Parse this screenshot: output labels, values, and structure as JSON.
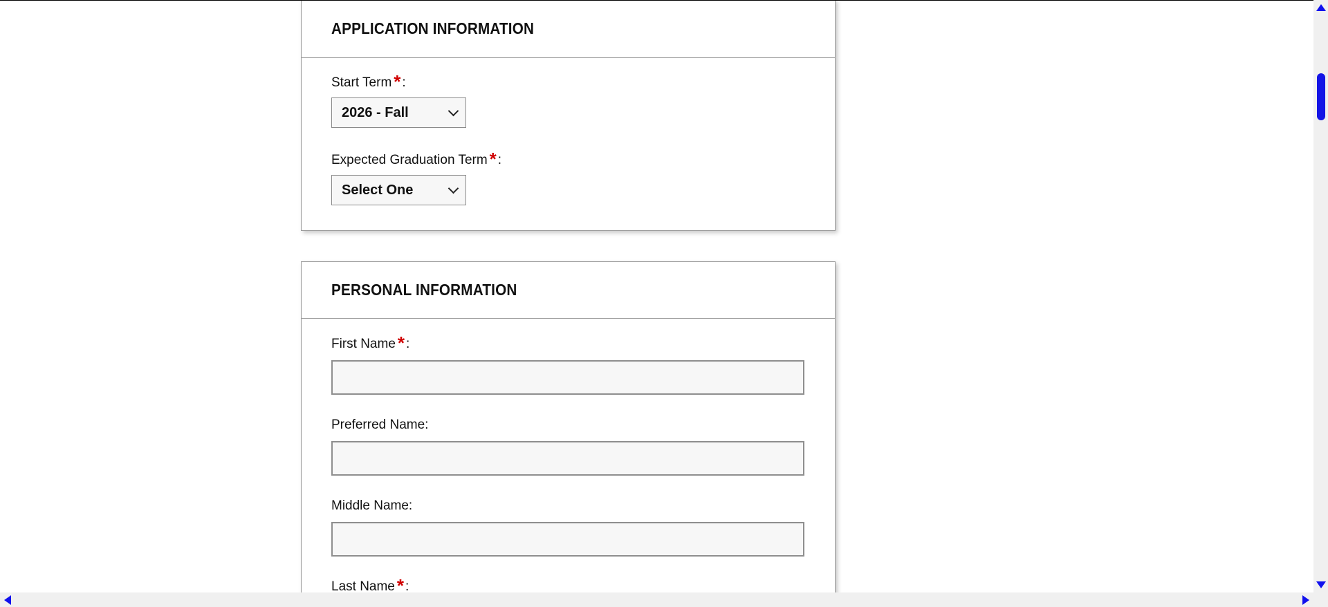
{
  "application_section": {
    "title": "APPLICATION INFORMATION",
    "start_term": {
      "label": "Start Term",
      "required_mark": "*",
      "suffix": ":",
      "selected": "2026 - Fall"
    },
    "graduation_term": {
      "label": "Expected Graduation Term",
      "required_mark": "*",
      "suffix": ":",
      "selected": "Select One"
    }
  },
  "personal_section": {
    "title": "PERSONAL INFORMATION",
    "first_name": {
      "label": "First Name",
      "required_mark": "*",
      "suffix": ":",
      "value": ""
    },
    "preferred_name": {
      "label": "Preferred Name:",
      "value": ""
    },
    "middle_name": {
      "label": "Middle Name:",
      "value": ""
    },
    "last_name": {
      "label": "Last Name",
      "required_mark": "*",
      "suffix": ":"
    }
  },
  "colors": {
    "required": "#d00000",
    "scrollbar_accent": "#1414e6",
    "field_background": "#f7f7f7",
    "border": "#9a9a9a"
  },
  "icons": {
    "select_arrow": "chevron-down-icon",
    "scroll_up": "arrow-up-icon",
    "scroll_down": "arrow-down-icon",
    "scroll_left": "arrow-left-icon",
    "scroll_right": "arrow-right-icon"
  }
}
